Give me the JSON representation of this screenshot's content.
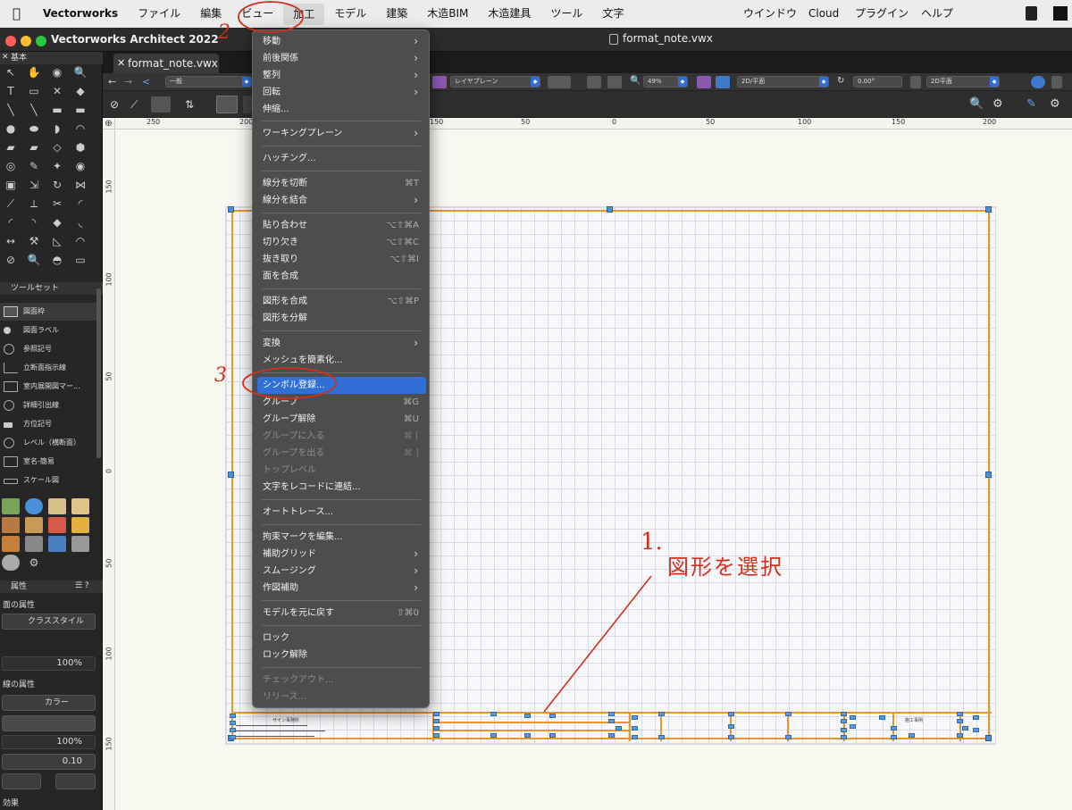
{
  "menubar": {
    "items": [
      "Vectorworks",
      "ファイル",
      "編集",
      "ビュー",
      "加工",
      "モデル",
      "建築",
      "木造BIM",
      "木造建具",
      "ツール",
      "文字"
    ],
    "right_items": [
      "ウインドウ",
      "Cloud",
      "プラグイン",
      "ヘルプ"
    ]
  },
  "window": {
    "title": "Vectorworks Architect 2022",
    "doc_title": "format_note.vwx",
    "tab": "format_note.vwx"
  },
  "palette": {
    "basic_title": "基本",
    "toolset_title": "ツールセット",
    "toolset_items": [
      "図面枠",
      "図面ラベル",
      "参照記号",
      "立断面指示線",
      "室内展開図マー...",
      "詳細引出線",
      "方位記号",
      "レベル（横断面）",
      "室名-簡易",
      "スケール図"
    ],
    "attr_title": "属性",
    "fill_label": "面の属性",
    "fill_style": "クラススタイル",
    "fill_opacity": "100%",
    "line_label": "線の属性",
    "line_color": "カラー",
    "line_opacity": "100%",
    "line_weight": "0.10",
    "effects_label": "効果"
  },
  "toolbar": {
    "class_value": "一般",
    "layer_plane": "レイヤプレーン",
    "zoom": "49%",
    "view_mode": "2D/平面",
    "rotation": "0.00°",
    "plane_mode": "2D平面"
  },
  "rulers": {
    "h_ticks": [
      "250",
      "200",
      "150",
      "100",
      "50",
      "0",
      "50",
      "100",
      "150",
      "200"
    ],
    "v_ticks": [
      "150",
      "100",
      "50",
      "0",
      "50",
      "100",
      "150"
    ]
  },
  "menu": {
    "items": [
      {
        "label": "移動",
        "type": "submenu"
      },
      {
        "label": "前後関係",
        "type": "submenu"
      },
      {
        "label": "整列",
        "type": "submenu"
      },
      {
        "label": "回転",
        "type": "submenu"
      },
      {
        "label": "伸縮...",
        "type": "item"
      },
      {
        "label": "ワーキングプレーン",
        "type": "submenu"
      },
      {
        "label": "ハッチング...",
        "type": "item"
      },
      {
        "label": "線分を切断",
        "shortcut": "⌘T"
      },
      {
        "label": "線分を結合",
        "type": "submenu"
      },
      {
        "label": "貼り合わせ",
        "shortcut": "⌥⇧⌘A"
      },
      {
        "label": "切り欠き",
        "shortcut": "⌥⇧⌘C"
      },
      {
        "label": "抜き取り",
        "shortcut": "⌥⇧⌘I"
      },
      {
        "label": "面を合成",
        "type": "item"
      },
      {
        "label": "図形を合成",
        "shortcut": "⌥⇧⌘P"
      },
      {
        "label": "図形を分解",
        "type": "item"
      },
      {
        "label": "変換",
        "type": "submenu"
      },
      {
        "label": "メッシュを簡素化...",
        "type": "item"
      },
      {
        "label": "シンボル登録...",
        "type": "highlighted"
      },
      {
        "label": "グループ",
        "shortcut": "⌘G"
      },
      {
        "label": "グループ解除",
        "shortcut": "⌘U"
      },
      {
        "label": "グループに入る",
        "shortcut": "⌘ [",
        "disabled": true
      },
      {
        "label": "グループを出る",
        "shortcut": "⌘ ]",
        "disabled": true
      },
      {
        "label": "トップレベル",
        "disabled": true
      },
      {
        "label": "文字をレコードに連結...",
        "type": "item"
      },
      {
        "label": "オートトレース...",
        "type": "item"
      },
      {
        "label": "拘束マークを編集...",
        "type": "item"
      },
      {
        "label": "補助グリッド",
        "type": "submenu"
      },
      {
        "label": "スムージング",
        "type": "submenu"
      },
      {
        "label": "作図補助",
        "type": "submenu"
      },
      {
        "label": "モデルを元に戻す",
        "shortcut": "⇧⌘0"
      },
      {
        "label": "ロック",
        "type": "item"
      },
      {
        "label": "ロック解除",
        "type": "item"
      },
      {
        "label": "チェックアウト...",
        "disabled": true
      },
      {
        "label": "リリース...",
        "disabled": true
      }
    ]
  },
  "annotations": {
    "step2": "2",
    "step3": "3",
    "step1": "1.",
    "note": "図形を選択"
  },
  "titleblock": {
    "company": "ザイン事務所",
    "office": "施工事例"
  }
}
